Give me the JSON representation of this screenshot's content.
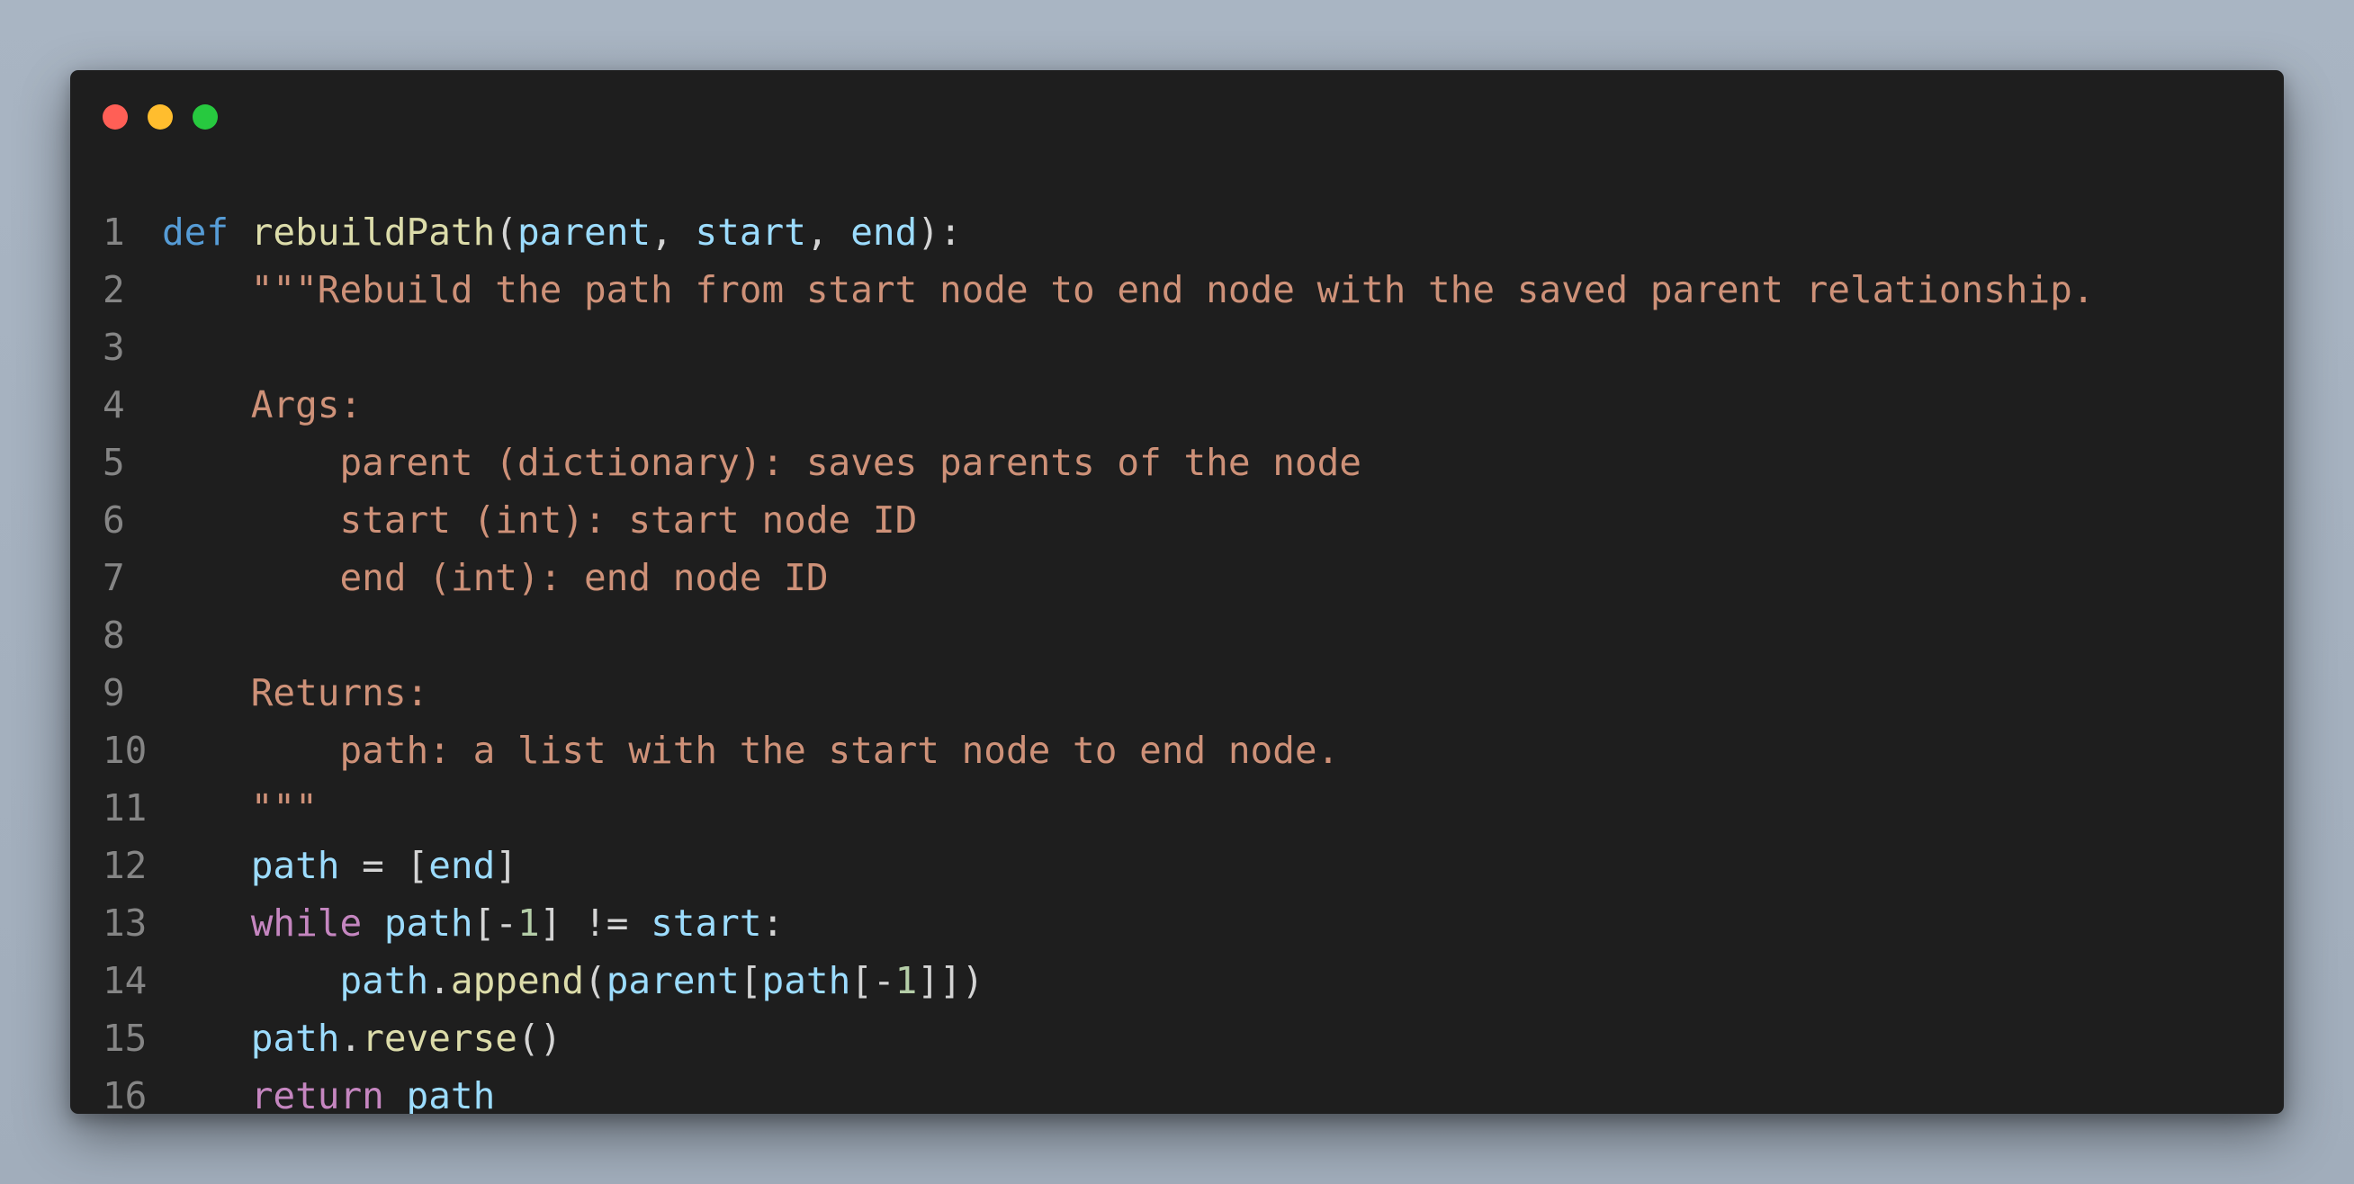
{
  "window": {
    "controls": [
      {
        "name": "close",
        "color": "#ff5f56"
      },
      {
        "name": "minimize",
        "color": "#ffbd2e"
      },
      {
        "name": "maximize",
        "color": "#27c93f"
      }
    ]
  },
  "code": {
    "language": "python",
    "lines": [
      {
        "n": "1",
        "tokens": [
          {
            "t": "def",
            "c": "kw"
          },
          {
            "t": " ",
            "c": "pun"
          },
          {
            "t": "rebuildPath",
            "c": "fn"
          },
          {
            "t": "(",
            "c": "pun"
          },
          {
            "t": "parent",
            "c": "var"
          },
          {
            "t": ", ",
            "c": "pun"
          },
          {
            "t": "start",
            "c": "var"
          },
          {
            "t": ", ",
            "c": "pun"
          },
          {
            "t": "end",
            "c": "var"
          },
          {
            "t": "):",
            "c": "pun"
          }
        ]
      },
      {
        "n": "2",
        "tokens": [
          {
            "t": "    \"\"\"Rebuild the path from start node to end node with the saved parent relationship.",
            "c": "str"
          }
        ]
      },
      {
        "n": "3",
        "tokens": []
      },
      {
        "n": "4",
        "tokens": [
          {
            "t": "    Args:",
            "c": "str"
          }
        ]
      },
      {
        "n": "5",
        "tokens": [
          {
            "t": "        parent (dictionary): saves parents of the node",
            "c": "str"
          }
        ]
      },
      {
        "n": "6",
        "tokens": [
          {
            "t": "        start (int): start node ID",
            "c": "str"
          }
        ]
      },
      {
        "n": "7",
        "tokens": [
          {
            "t": "        end (int): end node ID",
            "c": "str"
          }
        ]
      },
      {
        "n": "8",
        "tokens": []
      },
      {
        "n": "9",
        "tokens": [
          {
            "t": "    Returns:",
            "c": "str"
          }
        ]
      },
      {
        "n": "10",
        "tokens": [
          {
            "t": "        path: a list with the start node to end node.",
            "c": "str"
          }
        ]
      },
      {
        "n": "11",
        "tokens": [
          {
            "t": "    \"\"\"",
            "c": "str"
          }
        ]
      },
      {
        "n": "12",
        "tokens": [
          {
            "t": "    ",
            "c": "pun"
          },
          {
            "t": "path",
            "c": "var"
          },
          {
            "t": " = [",
            "c": "pun"
          },
          {
            "t": "end",
            "c": "var"
          },
          {
            "t": "]",
            "c": "pun"
          }
        ]
      },
      {
        "n": "13",
        "tokens": [
          {
            "t": "    ",
            "c": "pun"
          },
          {
            "t": "while",
            "c": "ctl"
          },
          {
            "t": " ",
            "c": "pun"
          },
          {
            "t": "path",
            "c": "var"
          },
          {
            "t": "[-",
            "c": "pun"
          },
          {
            "t": "1",
            "c": "num"
          },
          {
            "t": "] != ",
            "c": "pun"
          },
          {
            "t": "start",
            "c": "var"
          },
          {
            "t": ":",
            "c": "pun"
          }
        ]
      },
      {
        "n": "14",
        "tokens": [
          {
            "t": "        ",
            "c": "pun"
          },
          {
            "t": "path",
            "c": "var"
          },
          {
            "t": ".",
            "c": "pun"
          },
          {
            "t": "append",
            "c": "fn"
          },
          {
            "t": "(",
            "c": "pun"
          },
          {
            "t": "parent",
            "c": "var"
          },
          {
            "t": "[",
            "c": "pun"
          },
          {
            "t": "path",
            "c": "var"
          },
          {
            "t": "[-",
            "c": "pun"
          },
          {
            "t": "1",
            "c": "num"
          },
          {
            "t": "]])",
            "c": "pun"
          }
        ]
      },
      {
        "n": "15",
        "tokens": [
          {
            "t": "    ",
            "c": "pun"
          },
          {
            "t": "path",
            "c": "var"
          },
          {
            "t": ".",
            "c": "pun"
          },
          {
            "t": "reverse",
            "c": "fn"
          },
          {
            "t": "()",
            "c": "pun"
          }
        ]
      },
      {
        "n": "16",
        "tokens": [
          {
            "t": "    ",
            "c": "pun"
          },
          {
            "t": "return",
            "c": "ctl"
          },
          {
            "t": " ",
            "c": "pun"
          },
          {
            "t": "path",
            "c": "var"
          }
        ]
      }
    ]
  }
}
